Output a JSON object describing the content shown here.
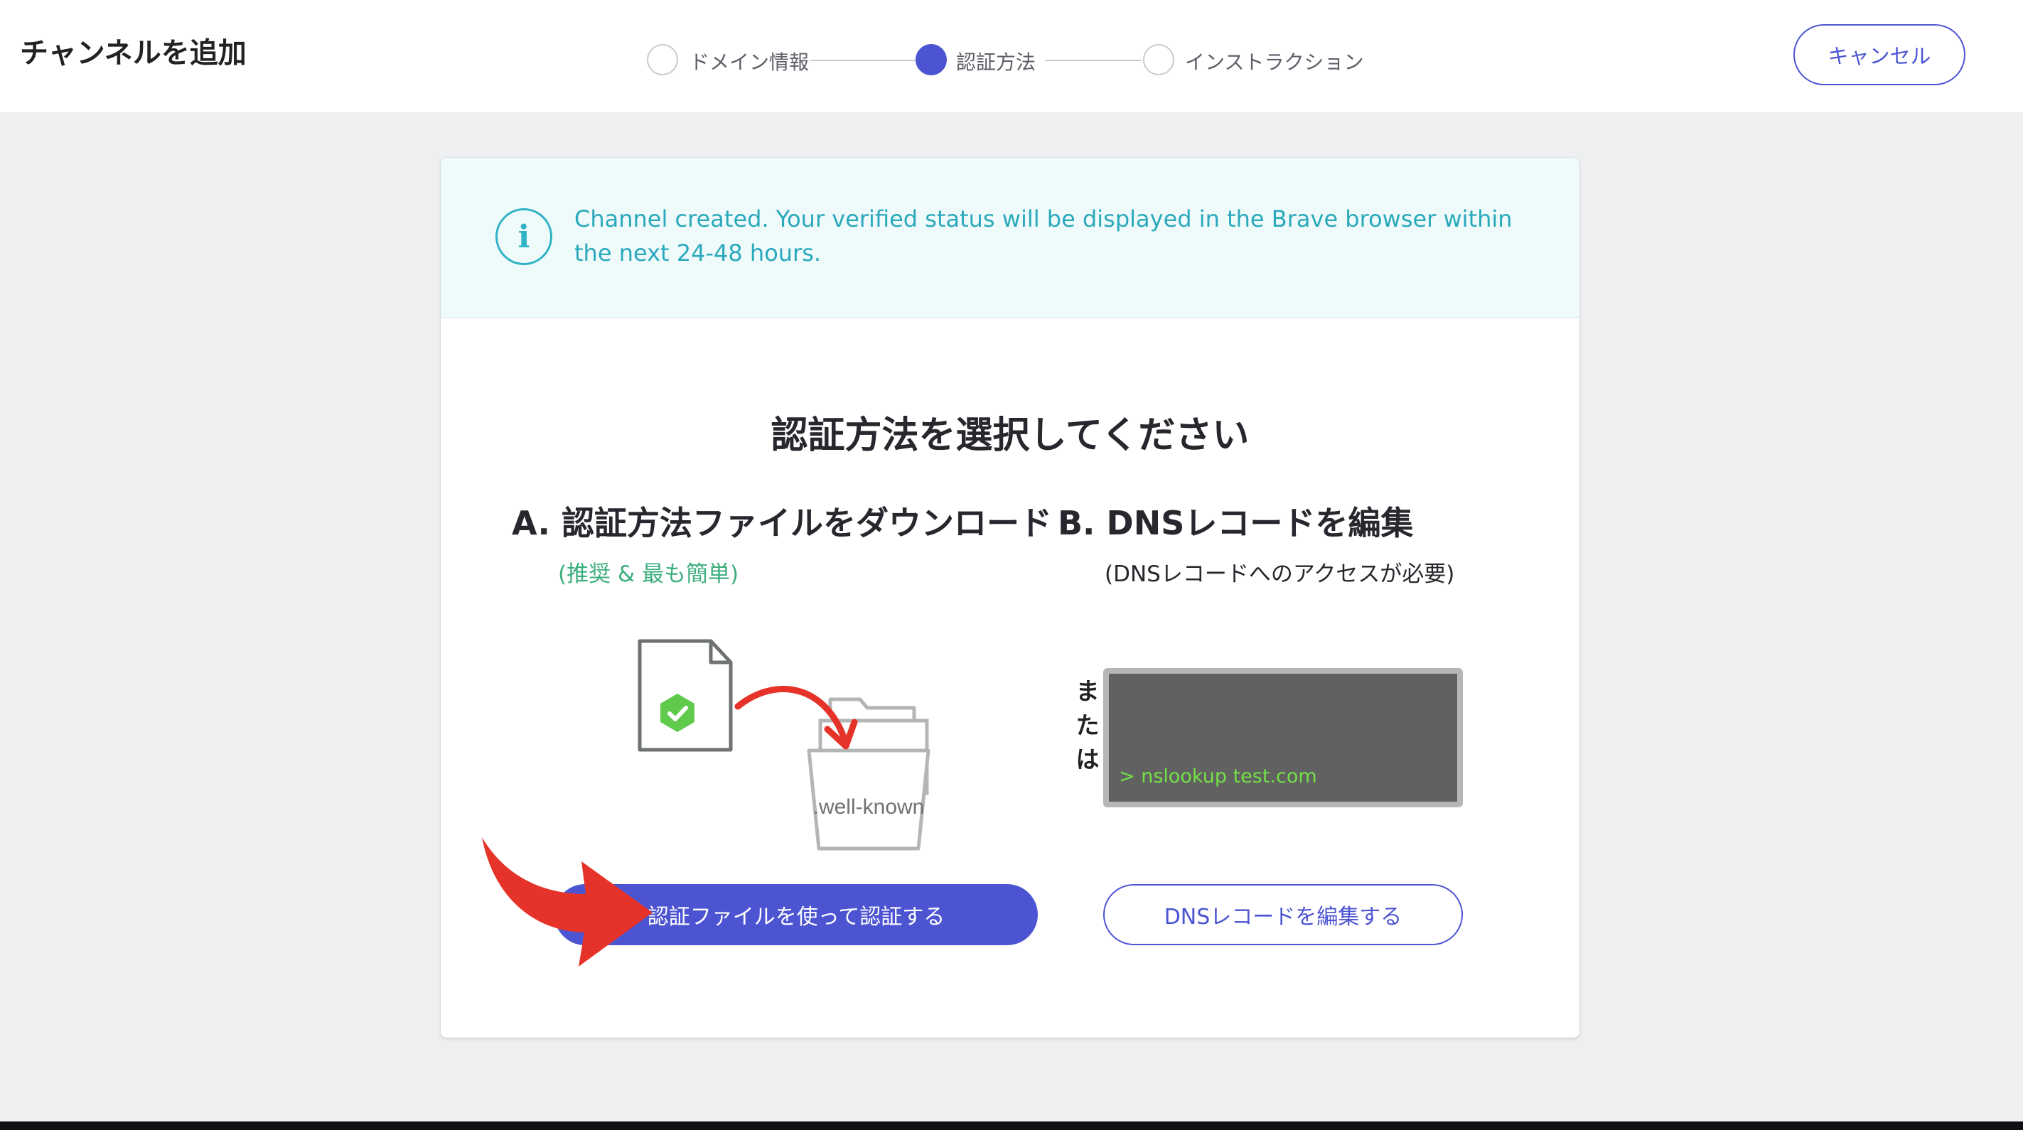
{
  "header": {
    "title": "チャンネルを追加",
    "steps": [
      {
        "label": "ドメイン情報",
        "state": "inactive"
      },
      {
        "label": "認証方法",
        "state": "active"
      },
      {
        "label": "インストラクション",
        "state": "inactive"
      }
    ],
    "cancel_label": "キャンセル"
  },
  "banner": {
    "icon": "info-icon",
    "text": "Channel created. Your verified status will be displayed in the Brave browser within the next 24-48 hours."
  },
  "main": {
    "heading": "認証方法を選択してください",
    "option_a": {
      "heading": "A.  認証方法ファイルをダウンロード",
      "subtitle": "(推奨 & 最も簡単)",
      "folder_label": ".well-known",
      "button_label": "認証ファイルを使って認証する"
    },
    "or_text": "または",
    "option_b": {
      "heading": "B.  DNSレコードを編集",
      "subtitle": "(DNSレコードへのアクセスが必要)",
      "terminal_text": "> nslookup test.com",
      "button_label": "DNSレコードを編集する"
    }
  },
  "colors": {
    "accent": "#4c54d2",
    "info": "#2fb3c5",
    "success": "#3cad7d",
    "terminal_text": "#73e046",
    "arrow_red": "#e6332a"
  }
}
